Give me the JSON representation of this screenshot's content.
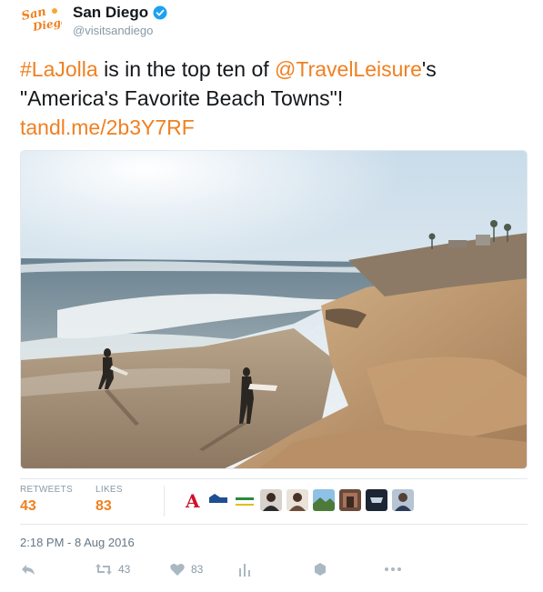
{
  "account": {
    "name": "San Diego",
    "handle": "@visitsandiego",
    "logo_text": "San Diego",
    "verified_icon": "verified-badge-icon"
  },
  "tweet": {
    "hashtag": "#LaJolla",
    "text_part1": " is in the top ten of ",
    "mention": "@TravelLeisure",
    "text_part2": "'s \"America's Favorite Beach Towns\"!",
    "link": "tandl.me/2b3Y7RF"
  },
  "stats": {
    "retweets_label": "RETWEETS",
    "retweets_value": "43",
    "likes_label": "LIKES",
    "likes_value": "83"
  },
  "timestamp": "2:18 PM - 8 Aug 2016",
  "actions": {
    "reply_icon": "reply-icon",
    "retweet_icon": "retweet-icon",
    "retweet_count": "43",
    "like_icon": "heart-icon",
    "like_count": "83",
    "analytics_icon": "analytics-icon",
    "moment_icon": "hexagon-icon",
    "more_icon": "more-icon"
  },
  "colors": {
    "accent": "#f08021",
    "muted": "#8899a6",
    "text": "#14171a",
    "border": "#e1e8ed",
    "verified": "#1da1f2"
  }
}
